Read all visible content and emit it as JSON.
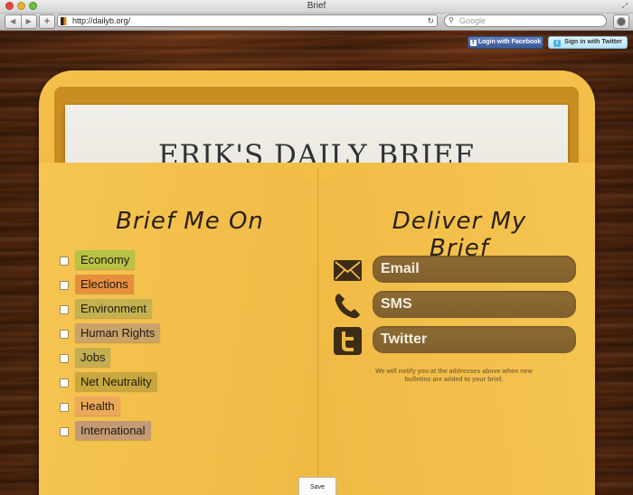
{
  "window": {
    "title": "Brief"
  },
  "toolbar": {
    "back_glyph": "◀",
    "forward_glyph": "▶",
    "new_tab_glyph": "+",
    "url": "http://dailyb.org/",
    "search_placeholder": "Google"
  },
  "social": {
    "facebook_label": "Login with Facebook",
    "twitter_label": "Sign in with Twitter"
  },
  "letter": {
    "title": "ERIK'S DAILY BRIEF"
  },
  "topics_heading": "Brief Me On",
  "delivery_heading": "Deliver My Brief",
  "topics": [
    {
      "label": "Economy",
      "color": "#b7c247",
      "checked": false
    },
    {
      "label": "Elections",
      "color": "#e88f3e",
      "checked": false
    },
    {
      "label": "Environment",
      "color": "#c3b24f",
      "checked": false
    },
    {
      "label": "Human Rights",
      "color": "#c9a36a",
      "checked": false
    },
    {
      "label": "Jobs",
      "color": "#c4ae52",
      "checked": false
    },
    {
      "label": "Net Neutrality",
      "color": "#c8a83e",
      "checked": false
    },
    {
      "label": "Health",
      "color": "#eda85a",
      "checked": false
    },
    {
      "label": "International",
      "color": "#c49a74",
      "checked": false
    }
  ],
  "delivery": [
    {
      "label": "Email",
      "icon": "envelope-icon"
    },
    {
      "label": "SMS",
      "icon": "phone-icon"
    },
    {
      "label": "Twitter",
      "icon": "twitter-icon"
    }
  ],
  "notify_text": "We will notify you at the addresses above when new bulletins are added to your brief.",
  "save_label": "Save",
  "colors": {
    "envelope": "#f0b942",
    "field": "#8a6730",
    "wood": "#5a2d12"
  }
}
